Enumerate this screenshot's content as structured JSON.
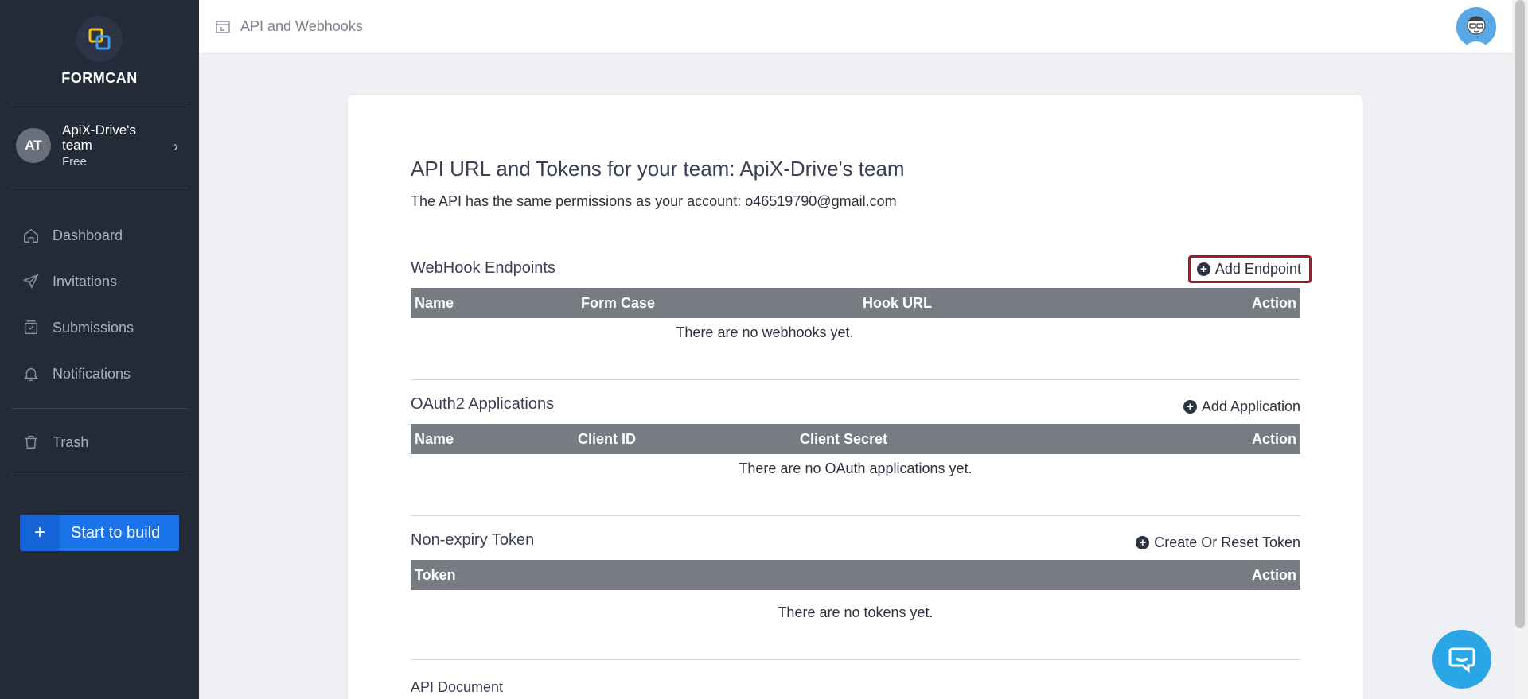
{
  "sidebar": {
    "brand": "FORMCAN",
    "team": {
      "initials": "AT",
      "name": "ApiX-Drive's team",
      "plan": "Free"
    },
    "nav": [
      {
        "label": "Dashboard",
        "icon": "home-icon"
      },
      {
        "label": "Invitations",
        "icon": "send-icon"
      },
      {
        "label": "Submissions",
        "icon": "inbox-icon"
      },
      {
        "label": "Notifications",
        "icon": "bell-icon"
      }
    ],
    "trash_label": "Trash",
    "build_button": "Start to build"
  },
  "header": {
    "title": "API and Webhooks"
  },
  "main": {
    "title": "API URL and Tokens for your team: ApiX-Drive's team",
    "subtitle": "The API has the same permissions as your account: o46519790@gmail.com",
    "webhooks": {
      "title": "WebHook Endpoints",
      "action": "Add Endpoint",
      "columns": [
        "Name",
        "Form Case",
        "Hook URL",
        "Action"
      ],
      "empty": "There are no webhooks yet."
    },
    "oauth": {
      "title": "OAuth2 Applications",
      "action": "Add Application",
      "columns": [
        "Name",
        "Client ID",
        "Client Secret",
        "Action"
      ],
      "empty": "There are no OAuth applications yet."
    },
    "tokens": {
      "title": "Non-expiry Token",
      "action": "Create Or Reset Token",
      "columns": [
        "Token",
        "Action"
      ],
      "empty": "There are no tokens yet."
    },
    "api_doc": "API Document"
  },
  "colors": {
    "sidebar_bg": "#232a38",
    "accent": "#1a73e8",
    "table_header": "#777c82",
    "highlight": "#9b1c24",
    "chat": "#2aa5e6"
  }
}
